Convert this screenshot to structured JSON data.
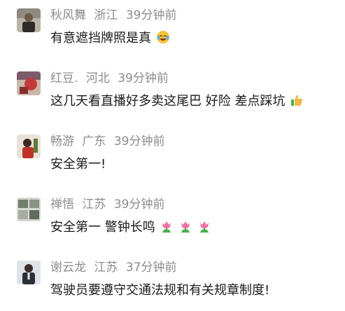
{
  "comments": [
    {
      "avatar_icon": "user-avatar-man-dark",
      "name": "秋风舞",
      "location": "浙江",
      "time": "39分钟前",
      "text": "有意遮挡牌照是真",
      "emojis": [
        "laughing-tears-emoji"
      ]
    },
    {
      "avatar_icon": "user-avatar-red-abstract",
      "name": "红豆.",
      "location": "河北",
      "time": "39分钟前",
      "text": "这几天看直播好多卖这尾巴 好险 差点踩坑",
      "emojis": [
        "thumbs-up-emoji"
      ]
    },
    {
      "avatar_icon": "user-avatar-person-red",
      "name": "畅游",
      "location": "广东",
      "time": "39分钟前",
      "text": "安全第一!",
      "emojis": []
    },
    {
      "avatar_icon": "user-avatar-landscape",
      "name": "禅悟",
      "location": "江苏",
      "time": "39分钟前",
      "text": "安全第一 警钟长鸣",
      "emojis": [
        "tulip-emoji",
        "tulip-emoji",
        "tulip-emoji"
      ]
    },
    {
      "avatar_icon": "user-avatar-man-suit",
      "name": "谢云龙",
      "location": "江苏",
      "time": "37分钟前",
      "text": "驾驶员要遵守交通法规和有关规章制度!",
      "emojis": []
    }
  ]
}
